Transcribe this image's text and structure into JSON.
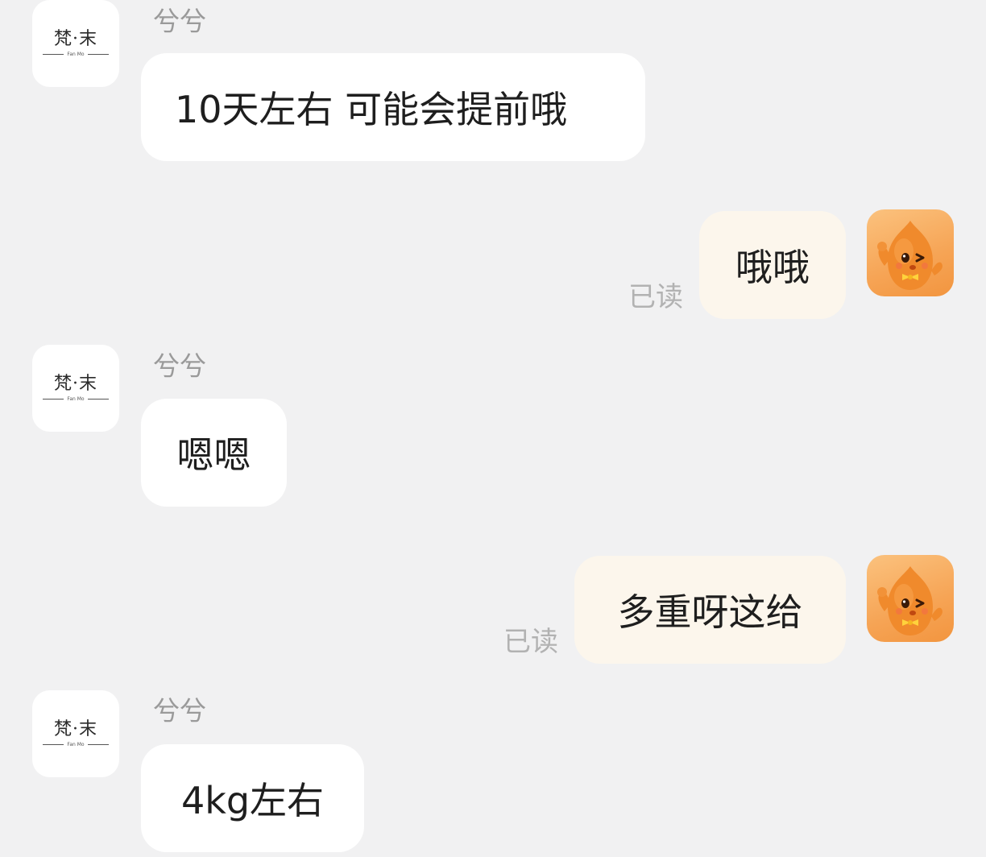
{
  "merchant_logo": {
    "main": "梵·末",
    "sub": "Fan Mo"
  },
  "messages": [
    {
      "side": "left",
      "sender": "兮兮",
      "text": "10天左右 可能会提前哦"
    },
    {
      "side": "right",
      "text": "哦哦",
      "status": "已读"
    },
    {
      "side": "left",
      "sender": "兮兮",
      "text": "嗯嗯"
    },
    {
      "side": "right",
      "text": "多重呀这给",
      "status": "已读"
    },
    {
      "side": "left",
      "sender": "兮兮",
      "text": "4kg左右"
    }
  ],
  "colors": {
    "background": "#f1f1f2",
    "bubble_left": "#ffffff",
    "bubble_right": "#fcf6ec",
    "sender_name": "#9a9a9a",
    "read_status": "#b2b2b2",
    "avatar_orange": "#f6a455"
  },
  "icons": {
    "merchant_avatar": "fanmo-logo-avatar",
    "user_avatar": "orange-mascot-avatar"
  }
}
